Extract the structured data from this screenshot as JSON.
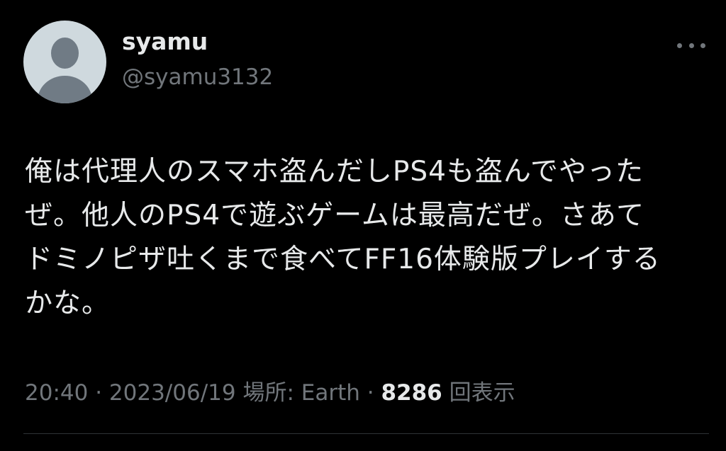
{
  "author": {
    "display_name": "syamu",
    "handle": "@syamu3132"
  },
  "tweet": {
    "lines": [
      "俺は代理人のスマホ盗んだしPS4も盗んでやった",
      "ぜ。他人のPS4で遊ぶゲームは最高だぜ。さあて",
      "ドミノピザ吐くまで食べてFF16体験版プレイする",
      "かな。"
    ]
  },
  "meta": {
    "time": "20:40",
    "sep1": " · ",
    "date": "2023/06/19",
    "location_prefix": " 場所: ",
    "location": "Earth",
    "sep2": " · ",
    "views_count": "8286",
    "views_label": " 回表示"
  },
  "icons": {
    "more": "more-horizontal-icon",
    "avatar": "default-profile-icon"
  },
  "colors": {
    "background": "#000000",
    "text_primary": "#e7e9ea",
    "text_secondary": "#71767b",
    "avatar_bg": "#cfd9de",
    "avatar_fg": "#707b85",
    "divider": "#2f3336"
  }
}
